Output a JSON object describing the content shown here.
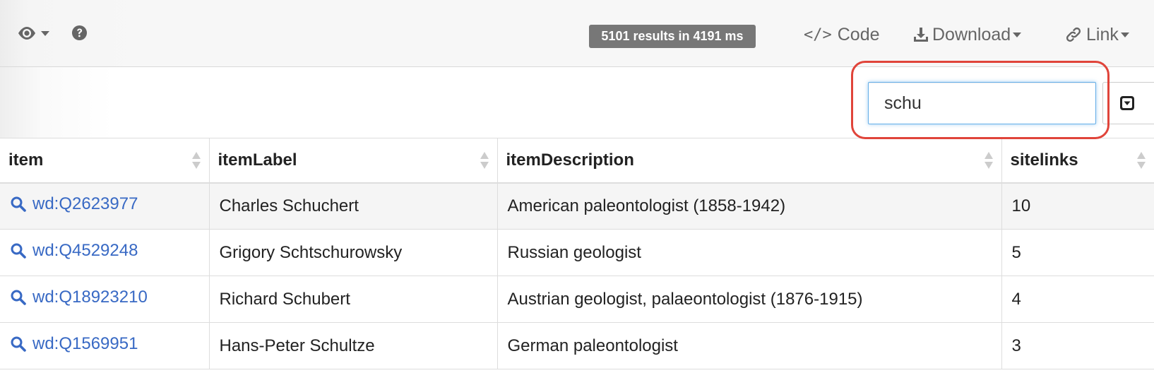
{
  "toolbar": {
    "results_badge": "5101 results in 4191 ms",
    "code_label": "Code",
    "code_icon_text": "</>",
    "download_label": "Download",
    "link_label": "Link"
  },
  "filter": {
    "value": "schu"
  },
  "table": {
    "columns": [
      "item",
      "itemLabel",
      "itemDescription",
      "sitelinks"
    ],
    "rows": [
      {
        "item": "wd:Q2623977",
        "itemLabel": "Charles Schuchert",
        "itemDescription": "American paleontologist (1858-1942)",
        "sitelinks": "10"
      },
      {
        "item": "wd:Q4529248",
        "itemLabel": "Grigory Schtschurowsky",
        "itemDescription": "Russian geologist",
        "sitelinks": "5"
      },
      {
        "item": "wd:Q18923210",
        "itemLabel": "Richard Schubert",
        "itemDescription": "Austrian geologist, palaeontologist (1876-1915)",
        "sitelinks": "4"
      },
      {
        "item": "wd:Q1569951",
        "itemLabel": "Hans-Peter Schultze",
        "itemDescription": "German paleontologist",
        "sitelinks": "3"
      }
    ]
  },
  "colors": {
    "link": "#3869c4",
    "highlight": "#e0443a",
    "badge": "#777777"
  },
  "icons": [
    "eye-icon",
    "help-icon",
    "code-icon",
    "download-icon",
    "link-icon",
    "column-toggle-icon",
    "search-icon",
    "sort-icon"
  ]
}
